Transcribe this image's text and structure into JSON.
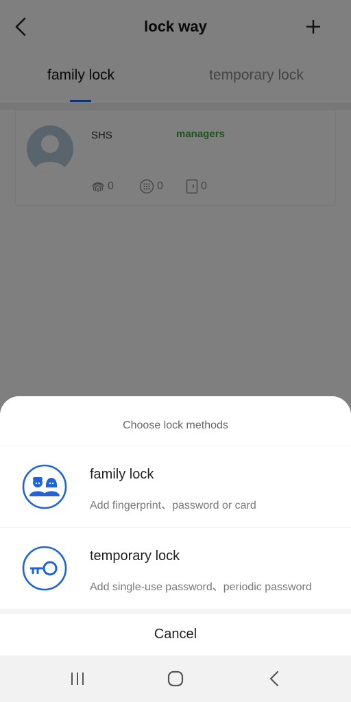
{
  "header": {
    "title": "lock way",
    "back_icon": "chevron-left-icon",
    "add_icon": "plus-icon"
  },
  "tabs": [
    {
      "label": "family lock",
      "active": true
    },
    {
      "label": "temporary lock",
      "active": false
    }
  ],
  "members": [
    {
      "name": "SHS",
      "role": "managers",
      "role_color": "#3aa93a",
      "fingerprint_count": "0",
      "password_count": "0",
      "card_count": "0"
    }
  ],
  "sheet": {
    "title": "Choose lock methods",
    "options": [
      {
        "title": "family lock",
        "description": "Add fingerprint、password or card",
        "icon": "family-users-icon"
      },
      {
        "title": "temporary lock",
        "description": "Add single-use password、periodic password",
        "icon": "key-icon"
      }
    ],
    "cancel_label": "Cancel"
  },
  "colors": {
    "accent": "#1e63d9",
    "overlay": "rgba(0,0,0,0.5)"
  },
  "navbar": {
    "icons": [
      "recent-apps-icon",
      "home-icon",
      "back-icon"
    ]
  }
}
